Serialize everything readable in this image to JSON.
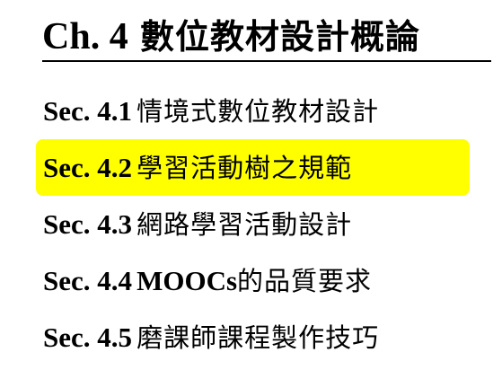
{
  "chapter": {
    "code": "Ch. 4",
    "title": "數位教材設計概論"
  },
  "sections": [
    {
      "code": "Sec. 4.1",
      "title": "情境式數位教材設計",
      "highlighted": false
    },
    {
      "code": "Sec. 4.2",
      "title": "學習活動樹之規範",
      "highlighted": true,
      "highlight_color": "#ffff00"
    },
    {
      "code": "Sec. 4.3",
      "title": "網路學習活動設計",
      "highlighted": false
    },
    {
      "code": "Sec. 4.4",
      "title_latin": "MOOCs",
      "title": "的品質要求",
      "highlighted": false
    },
    {
      "code": "Sec. 4.5",
      "title": "磨課師課程製作技巧",
      "highlighted": false
    }
  ]
}
